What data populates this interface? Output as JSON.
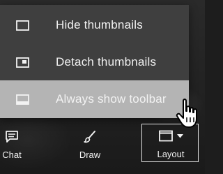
{
  "menu": {
    "items": [
      {
        "label": "Hide thumbnails",
        "icon": "square-outline-icon",
        "selected": false
      },
      {
        "label": "Detach thumbnails",
        "icon": "detached-window-icon",
        "selected": false
      },
      {
        "label": "Always show toolbar",
        "icon": "window-with-bottom-bar-icon",
        "selected": true
      }
    ]
  },
  "toolbar": {
    "chat_label": "Chat",
    "draw_label": "Draw",
    "layout_label": "Layout"
  },
  "colors": {
    "menu_bg": "#3f3f3f",
    "menu_selected_bg": "#b4b4b4",
    "text": "#f2f2f2"
  }
}
